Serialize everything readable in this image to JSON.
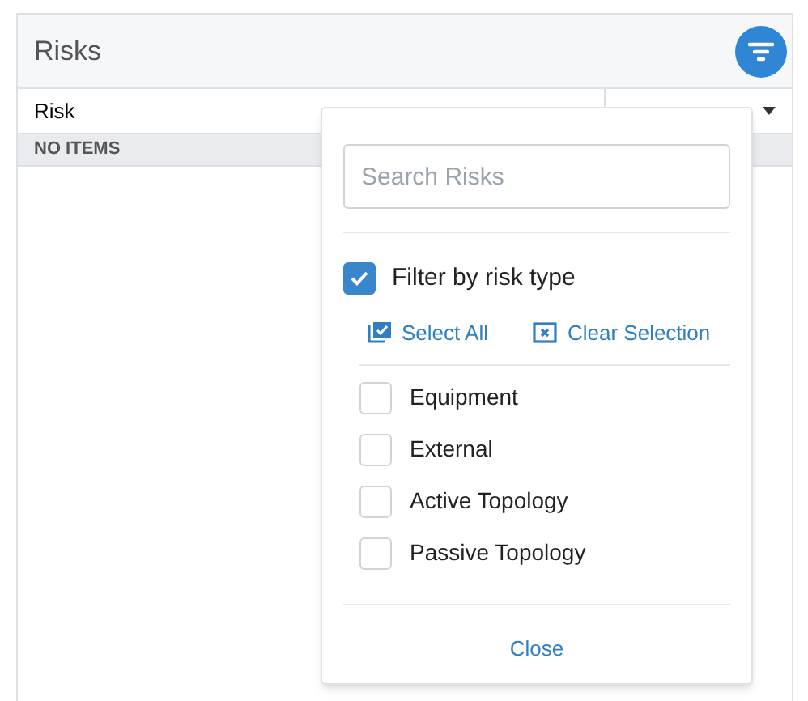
{
  "panel": {
    "title": "Risks"
  },
  "table": {
    "columns": [
      {
        "label": "Risk"
      }
    ],
    "empty_text": "NO ITEMS"
  },
  "filter_popup": {
    "search": {
      "placeholder": "Search Risks"
    },
    "filter_by_type": {
      "label": "Filter by risk type",
      "checked": true
    },
    "actions": [
      "Select All",
      "Clear Selection"
    ],
    "risk_types": [
      {
        "label": "Equipment",
        "checked": false
      },
      {
        "label": "External",
        "checked": false
      },
      {
        "label": "Active Topology",
        "checked": false
      },
      {
        "label": "Passive Topology",
        "checked": false
      }
    ],
    "close_label": "Close"
  }
}
